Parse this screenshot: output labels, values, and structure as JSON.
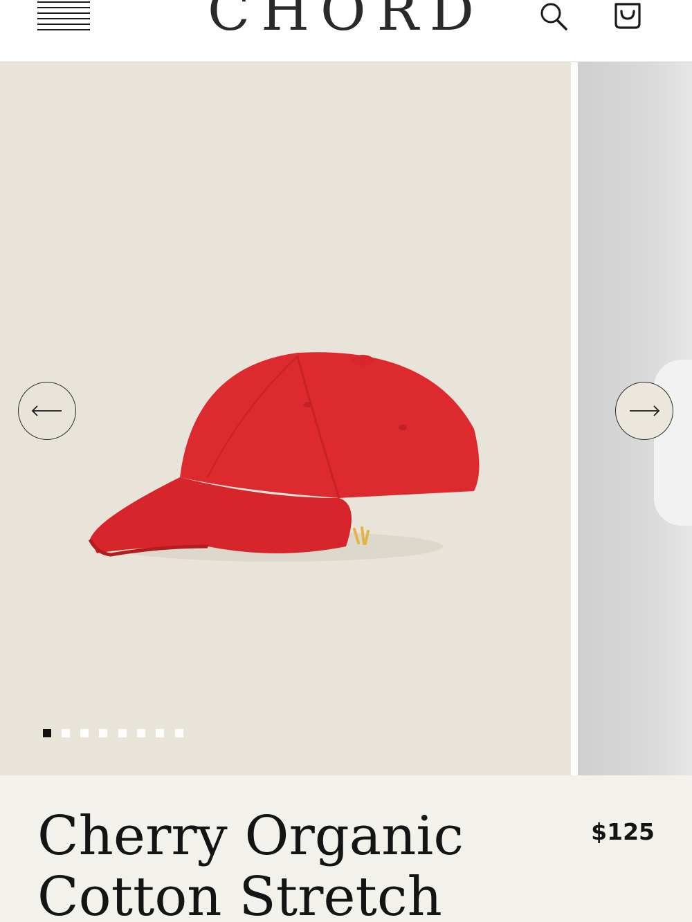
{
  "header": {
    "logo": "CHORD",
    "menu_icon": "hamburger-menu-icon",
    "search_icon": "search-icon",
    "cart_icon": "shopping-bag-icon"
  },
  "gallery": {
    "prev_icon": "arrow-left-icon",
    "next_icon": "arrow-right-icon",
    "total_slides": 8,
    "active_slide": 1,
    "background_color": "#e8e4da",
    "product_color": "#d9242b"
  },
  "product": {
    "title": "Cherry Organic Cotton Stretch",
    "price": "$125"
  }
}
